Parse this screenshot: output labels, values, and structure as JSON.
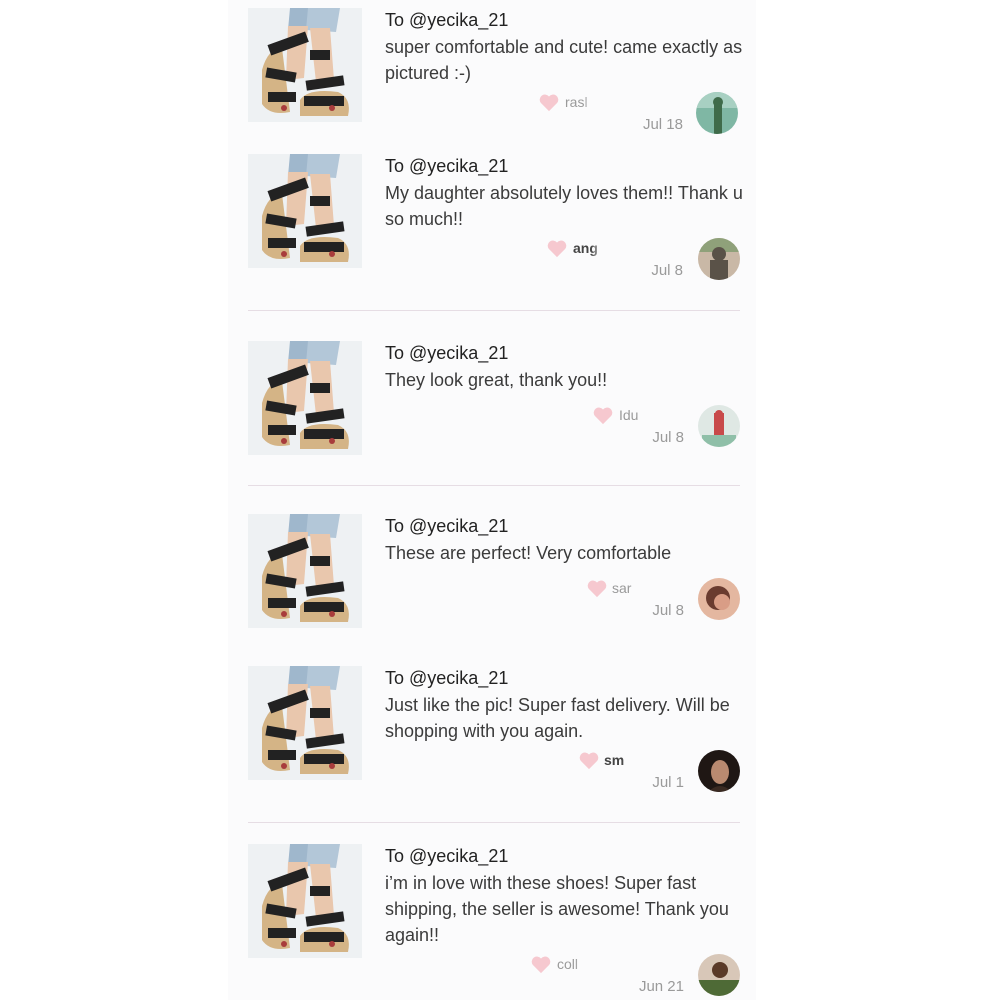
{
  "reviews": [
    {
      "to": "To @yecika_21",
      "message": "super comfortable and cute! came exactly as pictured :-)",
      "user": "rasl",
      "date": "Jul 18",
      "avatar_colors": [
        "#3f6b4a",
        "#7fb7a4"
      ]
    },
    {
      "to": "To @yecika_21",
      "message": "My daughter absolutely loves them!! Thank u so much!!",
      "user": "ang",
      "date": "Jul 8",
      "avatar_colors": [
        "#5a5248",
        "#c9b8a6"
      ]
    },
    {
      "to": "To @yecika_21",
      "message": "They look great, thank you!!",
      "user": "Idu",
      "date": "Jul 8",
      "avatar_colors": [
        "#c84a4a",
        "#dfe8e4"
      ]
    },
    {
      "to": "To @yecika_21",
      "message": "These are perfect! Very comfortable",
      "user": "sar",
      "date": "Jul 8",
      "avatar_colors": [
        "#6a3b2f",
        "#e4b7a0"
      ]
    },
    {
      "to": "To @yecika_21",
      "message": "Just like the pic! Super fast delivery. Will be shopping with you again.",
      "user": "sm",
      "date": "Jul 1",
      "avatar_colors": [
        "#1f1714",
        "#b98a70"
      ]
    },
    {
      "to": "To @yecika_21",
      "message": "i’m in love with these shoes! Super fast shipping, the seller is awesome! Thank you again!!",
      "user": "coll",
      "date": "Jun 21",
      "avatar_colors": [
        "#4e6a36",
        "#d8c7b8"
      ]
    }
  ],
  "colors": {
    "heart": "#f6c8cf",
    "text": "#3b3b3b",
    "muted": "#9a9a9a",
    "divider": "#e6dde4"
  },
  "icons": {
    "like": "heart-icon",
    "product": "sandal-photo"
  }
}
